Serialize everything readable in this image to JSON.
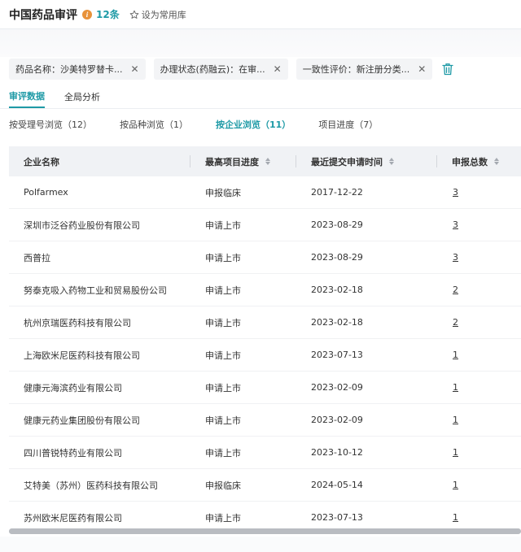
{
  "header": {
    "title": "中国药品审评",
    "count": "12条",
    "favorite_label": "设为常用库"
  },
  "filters": [
    {
      "label": "药品名称：沙美特罗替卡..."
    },
    {
      "label": "办理状态(药融云)：在审..."
    },
    {
      "label": "一致性评价：新注册分类..."
    }
  ],
  "main_tabs": [
    {
      "label": "审评数据",
      "active": true
    },
    {
      "label": "全局分析",
      "active": false
    }
  ],
  "sub_tabs": [
    {
      "label": "按受理号浏览（12）",
      "active": false
    },
    {
      "label": "按品种浏览（1）",
      "active": false
    },
    {
      "label": "按企业浏览（11）",
      "active": true
    },
    {
      "label": "项目进度（7）",
      "active": false
    }
  ],
  "table": {
    "columns": [
      "企业名称",
      "最高项目进度",
      "最近提交申请时间",
      "申报总数"
    ],
    "rows": [
      [
        "Polfarmex",
        "申报临床",
        "2017-12-22",
        "3"
      ],
      [
        "深圳市泛谷药业股份有限公司",
        "申请上市",
        "2023-08-29",
        "3"
      ],
      [
        "西普拉",
        "申请上市",
        "2023-08-29",
        "3"
      ],
      [
        "努泰克吸入药物工业和贸易股份公司",
        "申请上市",
        "2023-02-18",
        "2"
      ],
      [
        "杭州京瑞医药科技有限公司",
        "申请上市",
        "2023-02-18",
        "2"
      ],
      [
        "上海欧米尼医药科技有限公司",
        "申请上市",
        "2023-07-13",
        "1"
      ],
      [
        "健康元海滨药业有限公司",
        "申请上市",
        "2023-02-09",
        "1"
      ],
      [
        "健康元药业集团股份有限公司",
        "申请上市",
        "2023-02-09",
        "1"
      ],
      [
        "四川普锐特药业有限公司",
        "申请上市",
        "2023-10-12",
        "1"
      ],
      [
        "艾特美（苏州）医药科技有限公司",
        "申报临床",
        "2024-05-14",
        "1"
      ],
      [
        "苏州欧米尼医药有限公司",
        "申请上市",
        "2023-07-13",
        "1"
      ]
    ]
  },
  "colors": {
    "accent": "#1e9aa6",
    "info_badge": "#e8923a",
    "header_bg": "#f0f2f5"
  }
}
